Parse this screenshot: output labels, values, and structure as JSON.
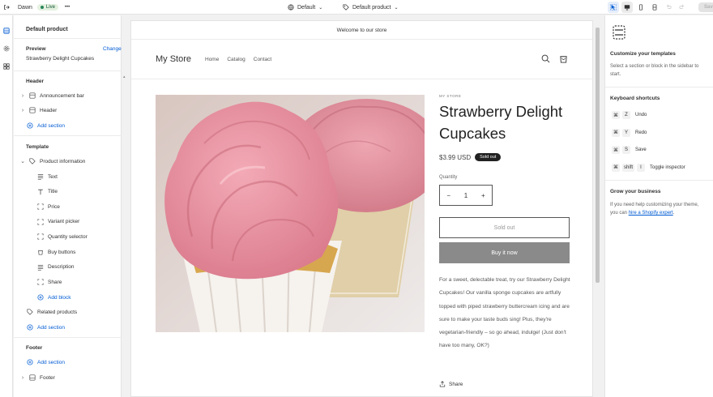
{
  "topbar": {
    "theme_name": "Dawn",
    "live_label": "Live",
    "more": "•••",
    "template_dropdown": "Default",
    "page_dropdown": "Default product",
    "save_label": "Save"
  },
  "sidebar": {
    "title": "Default product",
    "preview_label": "Preview",
    "change_label": "Change",
    "preview_value": "Strawberry Delight Cupcakes",
    "header_group": {
      "title": "Header",
      "items": [
        "Announcement bar",
        "Header"
      ],
      "add_section": "Add section"
    },
    "template_group": {
      "title": "Template",
      "section": "Product information",
      "blocks": [
        "Text",
        "Title",
        "Price",
        "Variant picker",
        "Quantity selector",
        "Buy buttons",
        "Description",
        "Share"
      ],
      "add_block": "Add block",
      "related": "Related products",
      "add_section": "Add section"
    },
    "footer_group": {
      "title": "Footer",
      "add_section": "Add section",
      "item": "Footer"
    }
  },
  "preview": {
    "announcement": "Welcome to our store",
    "store_name": "My Store",
    "nav": [
      "Home",
      "Catalog",
      "Contact"
    ],
    "vendor": "MY STORE",
    "product_title": "Strawberry Delight Cupcakes",
    "price": "$3.99 USD",
    "badge": "Sold out",
    "quantity_label": "Quantity",
    "quantity_value": "1",
    "minus": "−",
    "plus": "+",
    "sold_out_button": "Sold out",
    "buy_now_button": "Buy it now",
    "description": "For a sweet, delectable treat, try our Strawberry Delight Cupcakes! Our vanilla sponge cupcakes are artfully topped with piped strawberry buttercream icing and are sure to make your taste buds sing! Plus, they're vegetarian-friendly – so go ahead, indulge! (Just don't have too many, OK?)",
    "share": "Share"
  },
  "right_panel": {
    "customize_title": "Customize your templates",
    "customize_text": "Select a section or block in the sidebar to start.",
    "shortcuts_title": "Keyboard shortcuts",
    "shortcuts": [
      {
        "keys": [
          "Z"
        ],
        "label": "Undo"
      },
      {
        "keys": [
          "Y"
        ],
        "label": "Redo"
      },
      {
        "keys": [
          "S"
        ],
        "label": "Save"
      },
      {
        "keys": [
          "shift",
          "I"
        ],
        "label": "Toggle inspector"
      }
    ],
    "grow_title": "Grow your business",
    "grow_text": "If you need help customizing your theme, you can",
    "grow_link": "hire a Shopify expert",
    "grow_end": "."
  },
  "colors": {
    "accent": "#005bd3",
    "live_bg": "#e3f1df",
    "buy_button": "#8a8a8a",
    "frosting": "#e58a9a"
  }
}
